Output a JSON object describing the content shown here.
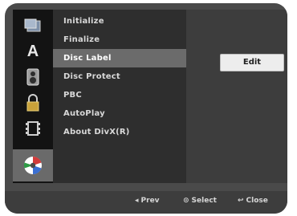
{
  "colors": {
    "screen_bg": "#4a4a4a",
    "icon_column": "#131313",
    "menu_panel": "#2e2e2e",
    "selected_row": "#6b6b6b",
    "button": "#ededed"
  },
  "sidebar": {
    "icons": [
      {
        "name": "disc-icon"
      },
      {
        "name": "language-icon"
      },
      {
        "name": "audio-icon"
      },
      {
        "name": "lock-icon"
      },
      {
        "name": "recording-icon"
      },
      {
        "name": "disc-setup-icon",
        "selected": true
      }
    ],
    "language_glyph": "A"
  },
  "menu": {
    "items": [
      {
        "label": "Initialize"
      },
      {
        "label": "Finalize"
      },
      {
        "label": "Disc Label",
        "selected": true
      },
      {
        "label": "Disc Protect"
      },
      {
        "label": "PBC"
      },
      {
        "label": "AutoPlay"
      },
      {
        "label": "About DivX(R)"
      }
    ]
  },
  "option_panel": {
    "button_label": "Edit"
  },
  "footer": {
    "prev_glyph": "◂",
    "prev_label": "Prev",
    "select_glyph": "⊙",
    "select_label": "Select",
    "close_glyph": "↩",
    "close_label": "Close"
  }
}
